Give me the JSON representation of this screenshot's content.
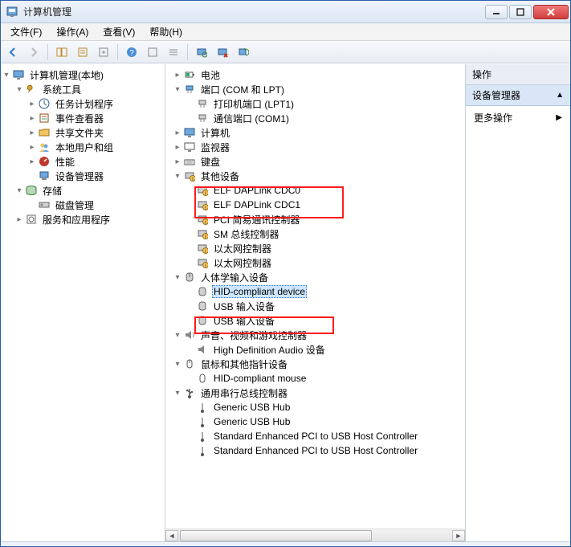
{
  "window": {
    "title": "计算机管理"
  },
  "menubar": {
    "file": "文件(F)",
    "action": "操作(A)",
    "view": "查看(V)",
    "help": "帮助(H)"
  },
  "left_tree": {
    "root": "计算机管理(本地)",
    "system_tools": "系统工具",
    "task_scheduler": "任务计划程序",
    "event_viewer": "事件查看器",
    "shared_folders": "共享文件夹",
    "local_users": "本地用户和组",
    "performance": "性能",
    "device_manager": "设备管理器",
    "storage": "存储",
    "disk_management": "磁盘管理",
    "services_apps": "服务和应用程序"
  },
  "middle_tree": {
    "battery": "电池",
    "ports": "端口 (COM 和 LPT)",
    "printer_port": "打印机端口 (LPT1)",
    "com_port": "通信端口 (COM1)",
    "computer": "计算机",
    "monitor": "监视器",
    "keyboard": "键盘",
    "other_devices": "其他设备",
    "elf1": "ELF DAPLink CDC0",
    "elf2": "ELF DAPLink CDC1",
    "pci": "PCI 简易通讯控制器",
    "sm": "SM 总线控制器",
    "eth1": "以太网控制器",
    "eth2": "以太网控制器",
    "hid_root": "人体学输入设备",
    "hid_compliant": "HID-compliant device",
    "usb_input1": "USB 输入设备",
    "usb_input2": "USB 输入设备",
    "audio_root": "声音、视频和游戏控制器",
    "hd_audio": "High Definition Audio 设备",
    "mouse_root": "鼠标和其他指针设备",
    "hid_mouse": "HID-compliant mouse",
    "usb_root": "通用串行总线控制器",
    "generic_hub1": "Generic USB Hub",
    "generic_hub2": "Generic USB Hub",
    "std_host1": "Standard Enhanced PCI to USB Host Controller",
    "std_host2": "Standard Enhanced PCI to USB Host Controller"
  },
  "right": {
    "header": "操作",
    "section": "设备管理器",
    "more": "更多操作"
  }
}
